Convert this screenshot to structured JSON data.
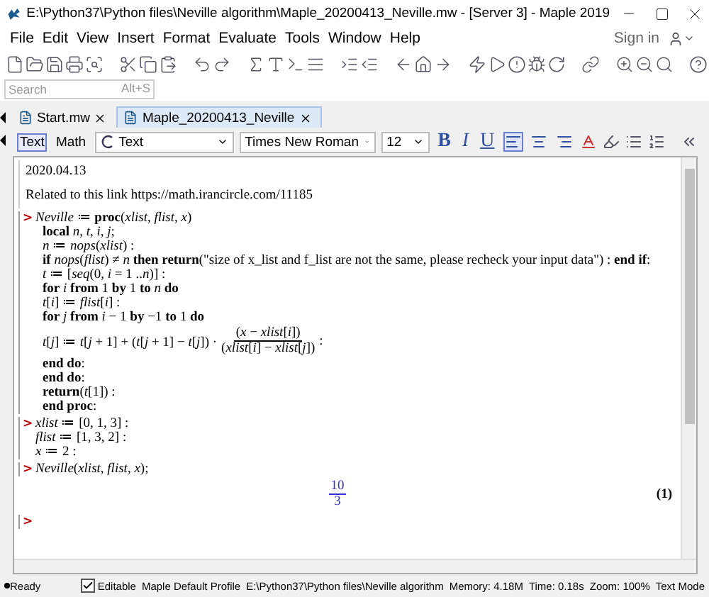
{
  "window": {
    "title": "E:\\Python37\\Python files\\Neville algorithm\\Maple_20200413_Neville.mw - [Server 3] - Maple 2019"
  },
  "menu": [
    "File",
    "Edit",
    "View",
    "Insert",
    "Format",
    "Evaluate",
    "Tools",
    "Window",
    "Help"
  ],
  "sign_in": "Sign in",
  "search": {
    "placeholder": "Search",
    "shortcut": "Alt+S"
  },
  "tabs": [
    {
      "label": "Start.mw",
      "selected": false
    },
    {
      "label": "Maple_20200413_Neville",
      "selected": true
    }
  ],
  "format_bar": {
    "modes": [
      {
        "label": "Text",
        "selected": true
      },
      {
        "label": "Math",
        "selected": false
      }
    ],
    "style": "Text",
    "font": "Times New Roman",
    "size": "12",
    "style_buttons": [
      "B",
      "I",
      "U"
    ],
    "alignment": [
      {
        "kind": "left",
        "selected": true
      },
      {
        "kind": "center",
        "selected": false
      },
      {
        "kind": "right",
        "selected": false
      }
    ]
  },
  "document": [
    {
      "kind": "text",
      "text": "2020.04.13"
    },
    {
      "kind": "text",
      "text": "Related to this link https://math.irancircle.com/11185"
    },
    {
      "kind": "input",
      "prompt": ">",
      "lines": [
        {
          "kind": "line",
          "text": "*Neville* ≔ **proc**(*xlist*, *flist*, *x*)"
        },
        {
          "kind": "line",
          "text": "**local** *n*, *t*, *i*, *j*;"
        },
        {
          "kind": "line",
          "text": "*n* ≔ *nops*(*xlist*) :"
        },
        {
          "kind": "line",
          "text": "**if** *nops*(*flist*) ≠ *n* **then return**(\"size of x_list and f_list are not the same, please recheck your input data\") : **end if**:"
        },
        {
          "kind": "line",
          "text": "*t* ≔ [*seq*(0, *i* = 1 ..*n*)] :"
        },
        {
          "kind": "line",
          "text": "**for** *i* **from** 1 **by** 1 **to** *n* **do**"
        },
        {
          "kind": "line",
          "text": "*t*[*i*] ≔ *flist*[*i*] :"
        },
        {
          "kind": "line",
          "text": "**for** *j* **from** *i* − 1 **by** −1 **to** 1 **do**"
        },
        {
          "kind": "fraction",
          "lead": "*t*[*j*] ≔ *t*[*j* + 1] + (*t*[*j* + 1] − *t*[*j*]) ·",
          "numerator": "(*x* − *xlist*[*i*])",
          "denominator": "(*xlist*[*i*] − *xlist*[*j*])",
          "tail": ":"
        },
        {
          "kind": "line",
          "text": "**end do**:"
        },
        {
          "kind": "line",
          "text": "**end do**:"
        },
        {
          "kind": "line",
          "text": "**return**(*t*[1]) :"
        },
        {
          "kind": "line",
          "text": "**end proc**:"
        }
      ]
    },
    {
      "kind": "input",
      "prompt": ">",
      "lines": [
        {
          "kind": "line",
          "text": "*xlist* ≔ [0, 1, 3] :"
        },
        {
          "kind": "line",
          "text": "*flist* ≔ [1, 3, 2] :"
        },
        {
          "kind": "line",
          "text": "*x* ≔ 2 :"
        }
      ]
    },
    {
      "kind": "input",
      "prompt": ">",
      "lines": [
        {
          "kind": "line",
          "text": "*Neville*(*xlist*, *flist*, *x*);"
        }
      ]
    },
    {
      "kind": "output",
      "numerator": "10",
      "denominator": "3",
      "label": "(1)"
    },
    {
      "kind": "prompt",
      "prompt": ">"
    }
  ],
  "status_bar": {
    "state": "Ready",
    "editable": {
      "label": "Editable",
      "checked": true
    },
    "profile": "Maple Default Profile",
    "path": "E:\\Python37\\Python files\\Neville algorithm",
    "memory": "Memory: 4.18M",
    "time": "Time: 0.18s",
    "zoom": "Zoom: 100%",
    "mode": "Text Mode"
  }
}
